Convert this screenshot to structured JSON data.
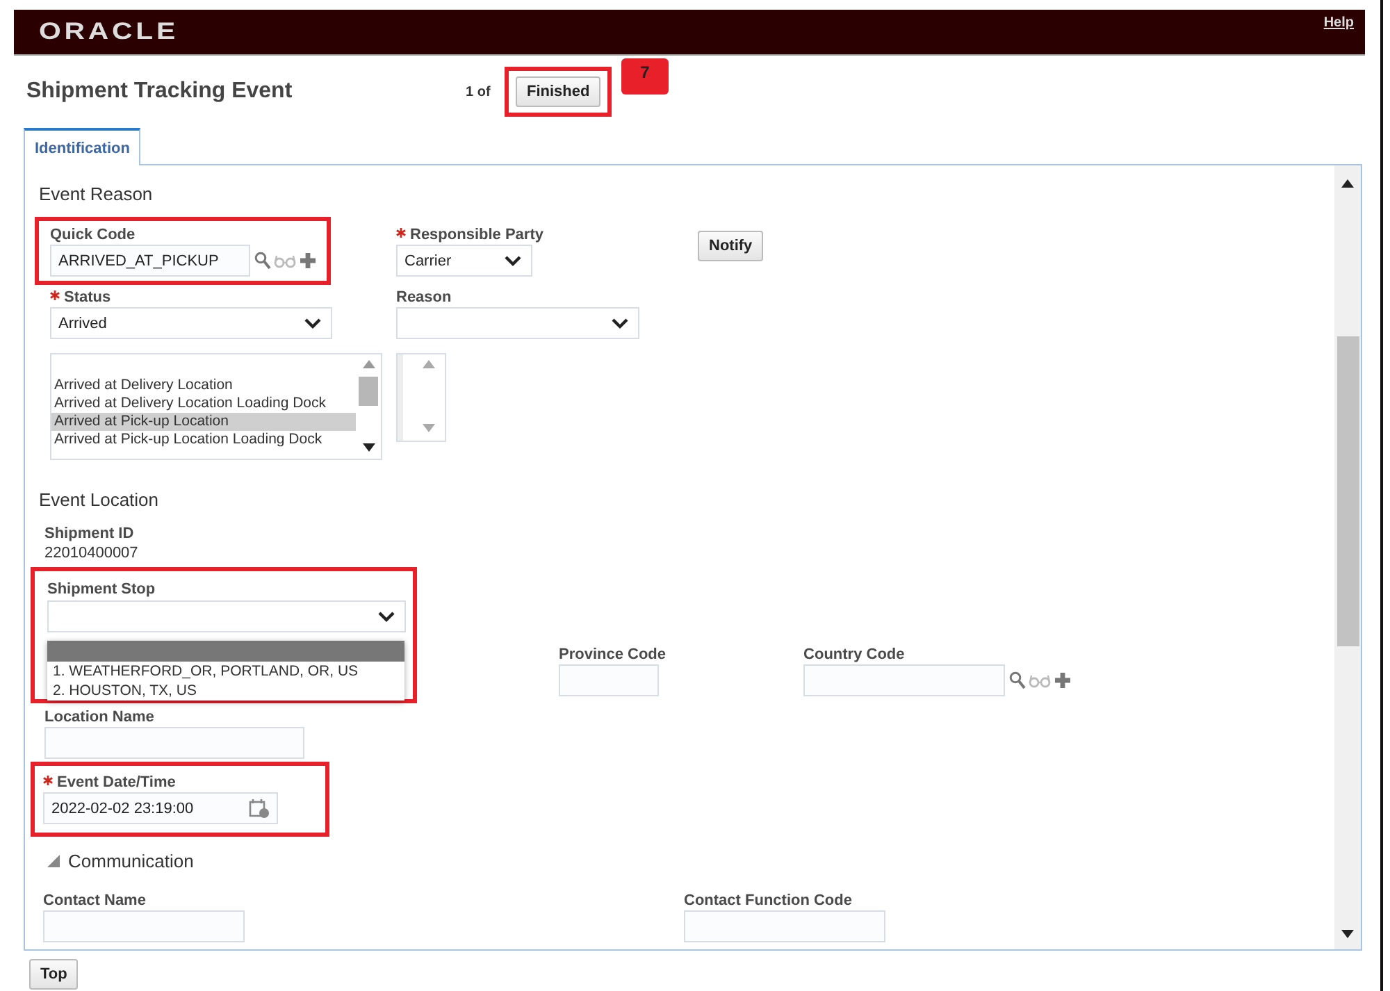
{
  "header": {
    "logo": "ORACLE",
    "help_link": "Help"
  },
  "page": {
    "title": "Shipment Tracking Event",
    "pager": "1 of",
    "finished_button": "Finished",
    "finished_highlighted": true,
    "callout": "7"
  },
  "tabs": [
    {
      "label": "Identification",
      "selected": true
    }
  ],
  "event_reason": {
    "heading": "Event Reason",
    "quick_code": {
      "label": "Quick Code",
      "value": "ARRIVED_AT_PICKUP",
      "highlighted": true
    },
    "responsible_party": {
      "label": "Responsible Party",
      "required": true,
      "value": "Carrier"
    },
    "notify_button": "Notify",
    "status": {
      "label": "Status",
      "required": true,
      "value": "Arrived"
    },
    "reason": {
      "label": "Reason"
    },
    "status_list": [
      {
        "label": "Arrived at Delivery Location",
        "selected": false
      },
      {
        "label": "Arrived at Delivery Location Loading Dock",
        "selected": false
      },
      {
        "label": "Arrived at Pick-up Location",
        "selected": true
      },
      {
        "label": "Arrived at Pick-up Location Loading Dock",
        "selected": false
      }
    ]
  },
  "event_location": {
    "heading": "Event Location",
    "shipment_id": {
      "label": "Shipment ID",
      "value": "22010400007"
    },
    "shipment_stop": {
      "label": "Shipment Stop",
      "highlighted": true,
      "empty_option_selected": true,
      "options": [
        {
          "label": "1. WEATHERFORD_OR, PORTLAND, OR, US",
          "selected": false
        },
        {
          "label": "2. HOUSTON, TX, US",
          "selected": false
        }
      ]
    },
    "province_code": {
      "label": "Province Code"
    },
    "country_code": {
      "label": "Country Code"
    },
    "location_name": {
      "label": "Location Name"
    },
    "event_datetime": {
      "label": "Event Date/Time",
      "required": true,
      "value": "2022-02-02 23:19:00",
      "highlighted": true
    }
  },
  "communication": {
    "heading": "Communication",
    "expanded": true,
    "contact_name": {
      "label": "Contact Name"
    },
    "contact_function_code": {
      "label": "Contact Function Code"
    }
  },
  "top_button": "Top"
}
